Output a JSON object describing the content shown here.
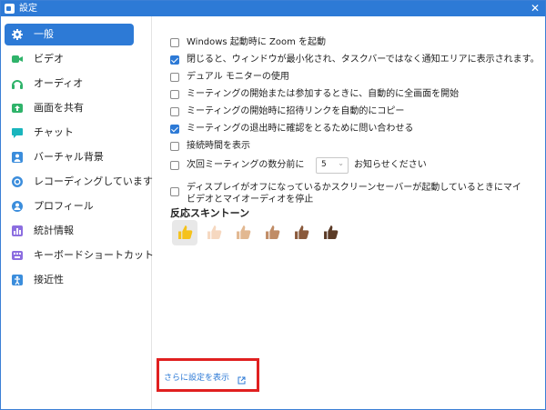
{
  "window": {
    "title": "設定",
    "close_glyph": "✕",
    "accent": "#2d7ad6"
  },
  "sidebar": {
    "items": [
      {
        "label": "一般",
        "icon": "gear-icon",
        "color": "#2d7ad6",
        "active": true
      },
      {
        "label": "ビデオ",
        "icon": "video-icon",
        "color": "#2fb36a"
      },
      {
        "label": "オーディオ",
        "icon": "headphones-icon",
        "color": "#2fb36a"
      },
      {
        "label": "画面を共有",
        "icon": "share-screen-icon",
        "color": "#2fb36a"
      },
      {
        "label": "チャット",
        "icon": "chat-icon",
        "color": "#19b5bd"
      },
      {
        "label": "バーチャル背景",
        "icon": "virtual-background-icon",
        "color": "#3b8ddc"
      },
      {
        "label": "レコーディングしています",
        "icon": "recording-icon",
        "color": "#3b8ddc"
      },
      {
        "label": "プロフィール",
        "icon": "profile-icon",
        "color": "#3b8ddc"
      },
      {
        "label": "統計情報",
        "icon": "statistics-icon",
        "color": "#8c6ee0"
      },
      {
        "label": "キーボードショートカット",
        "icon": "keyboard-icon",
        "color": "#8c6ee0"
      },
      {
        "label": "接近性",
        "icon": "accessibility-icon",
        "color": "#3b8ddc"
      }
    ]
  },
  "general": {
    "options": [
      {
        "label": "Windows 起動時に Zoom を起動",
        "checked": false
      },
      {
        "label": "閉じると、ウィンドウが最小化され、タスクバーではなく通知エリアに表示されます。",
        "checked": true
      },
      {
        "label": "デュアル モニターの使用",
        "checked": false
      },
      {
        "label": "ミーティングの開始または参加するときに、自動的に全画面を開始",
        "checked": false
      },
      {
        "label": "ミーティングの開始時に招待リンクを自動的にコピー",
        "checked": false
      },
      {
        "label": "ミーティングの退出時に確認をとるために問い合わせる",
        "checked": true
      },
      {
        "label": "接続時間を表示",
        "checked": false
      }
    ],
    "reminder": {
      "label": "次回ミーティングの数分前に",
      "value": "5",
      "suffix": "お知らせください",
      "checked": false
    },
    "screensaver": {
      "label": "ディスプレイがオフになっているかスクリーンセーバーが起動しているときにマイビデオとマイオーディオを停止",
      "checked": false
    },
    "skin_tone": {
      "title": "反応スキントーン",
      "tones": [
        {
          "name": "thumbs-up-default-icon",
          "color": "#f5c21b",
          "selected": true
        },
        {
          "name": "thumbs-up-light-icon",
          "color": "#f6d8c0"
        },
        {
          "name": "thumbs-up-medium-light-icon",
          "color": "#e2b891"
        },
        {
          "name": "thumbs-up-medium-icon",
          "color": "#c08c66"
        },
        {
          "name": "thumbs-up-medium-dark-icon",
          "color": "#8a5a3c"
        },
        {
          "name": "thumbs-up-dark-icon",
          "color": "#5b3b27"
        }
      ]
    },
    "more_settings": {
      "label": "さらに設定を表示",
      "icon": "external-link-icon",
      "highlight_color": "#e02020"
    }
  }
}
